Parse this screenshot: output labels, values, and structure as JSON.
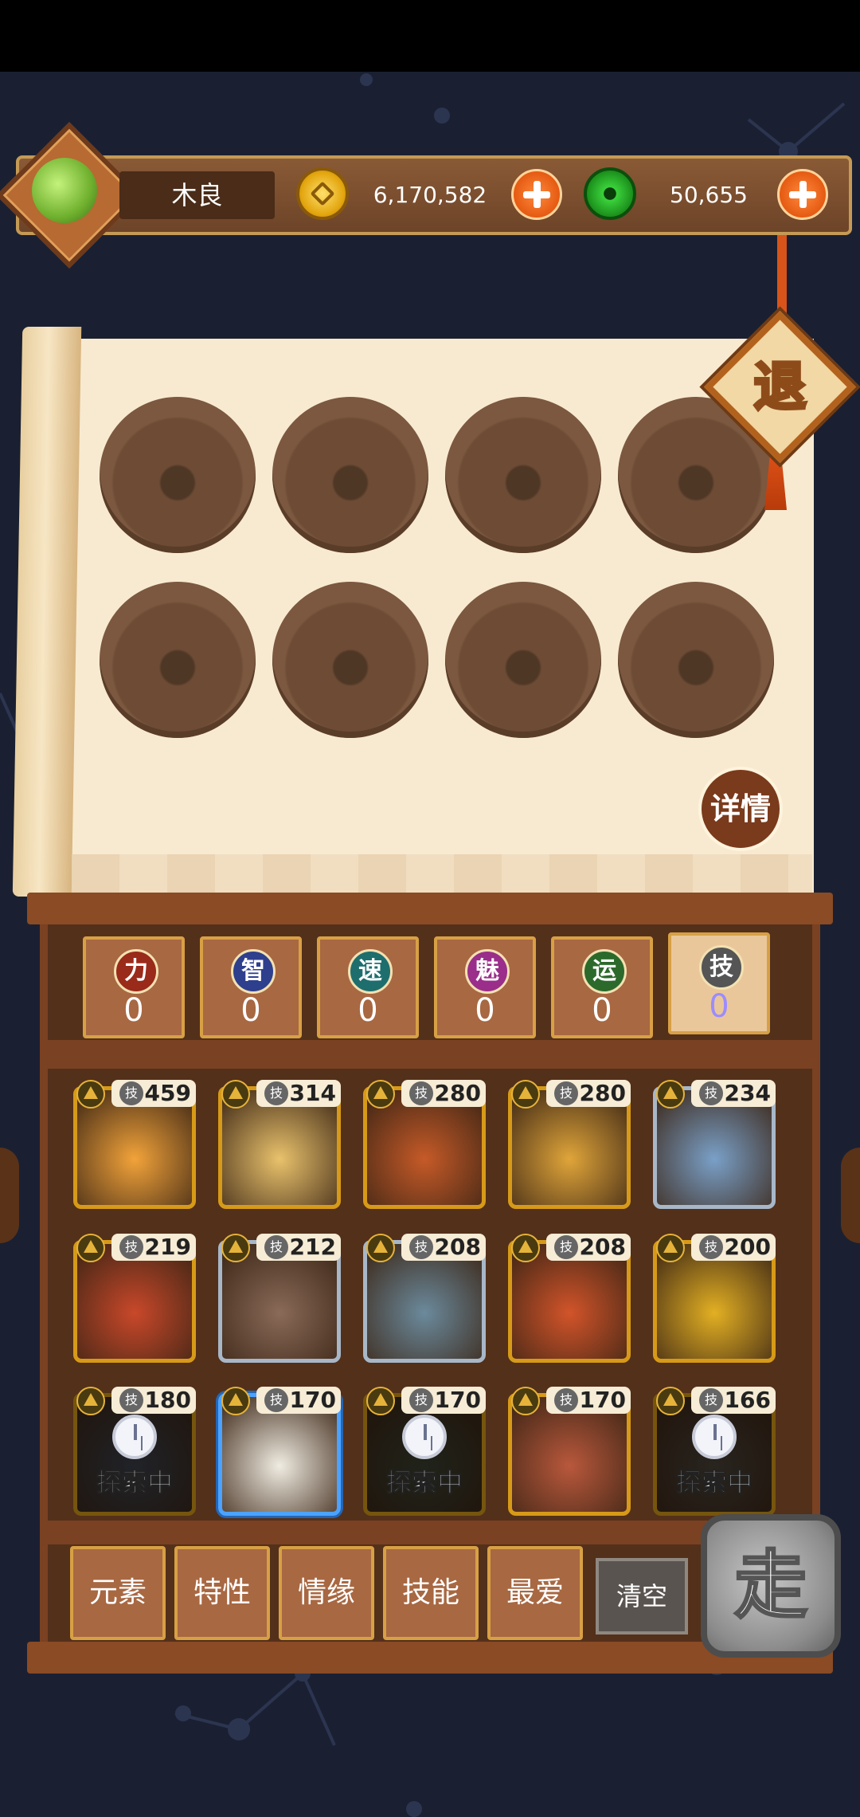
{
  "player": {
    "name": "木良"
  },
  "currency": {
    "gold": "6,170,582",
    "jade": "50,655"
  },
  "buttons": {
    "retreat": "退",
    "detail": "详情",
    "go": "走",
    "clear": "清空"
  },
  "stats": [
    {
      "key": "strength",
      "icon": "力",
      "value": "0",
      "color": "#9a2a1a"
    },
    {
      "key": "intellect",
      "icon": "智",
      "value": "0",
      "color": "#2e3f8e"
    },
    {
      "key": "speed",
      "icon": "速",
      "value": "0",
      "color": "#1e6e6e"
    },
    {
      "key": "charm",
      "icon": "魅",
      "value": "0",
      "color": "#9a2e8a"
    },
    {
      "key": "luck",
      "icon": "运",
      "value": "0",
      "color": "#2c6a2c"
    },
    {
      "key": "skill",
      "icon": "技",
      "value": "0",
      "color": "#555555"
    }
  ],
  "heroes": [
    {
      "value": "459",
      "skill_icon": "技",
      "status": ""
    },
    {
      "value": "314",
      "skill_icon": "技",
      "status": ""
    },
    {
      "value": "280",
      "skill_icon": "技",
      "status": ""
    },
    {
      "value": "280",
      "skill_icon": "技",
      "status": ""
    },
    {
      "value": "234",
      "skill_icon": "技",
      "status": ""
    },
    {
      "value": "219",
      "skill_icon": "技",
      "status": ""
    },
    {
      "value": "212",
      "skill_icon": "技",
      "status": ""
    },
    {
      "value": "208",
      "skill_icon": "技",
      "status": ""
    },
    {
      "value": "208",
      "skill_icon": "技",
      "status": ""
    },
    {
      "value": "200",
      "skill_icon": "技",
      "status": ""
    },
    {
      "value": "180",
      "skill_icon": "技",
      "status": "探索中"
    },
    {
      "value": "170",
      "skill_icon": "技",
      "status": ""
    },
    {
      "value": "170",
      "skill_icon": "技",
      "status": "探索中"
    },
    {
      "value": "170",
      "skill_icon": "技",
      "status": ""
    },
    {
      "value": "166",
      "skill_icon": "技",
      "status": "探索中"
    }
  ],
  "filters": [
    "元素",
    "特性",
    "情缘",
    "技能",
    "最爱"
  ]
}
